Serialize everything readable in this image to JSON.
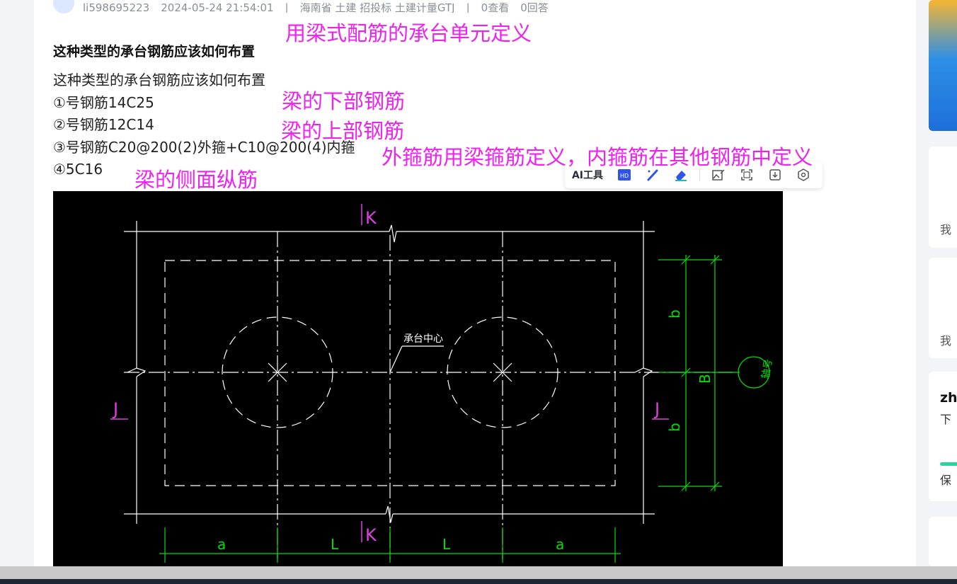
{
  "post": {
    "meta": {
      "username": "li598695223",
      "datetime": "2024-05-24 21:54:01",
      "region": "海南省  土建  招投标  土建计量GTJ",
      "views": "0查看",
      "answers": "0回答"
    },
    "title": "这种类型的承台钢筋应该如何布置",
    "lines": [
      "这种类型的承台钢筋应该如何布置",
      "①号钢筋14C25",
      "②号钢筋12C14",
      "③号钢筋C20@200(2)外箍+C10@200(4)内箍",
      "④5C16"
    ]
  },
  "annotations": {
    "a1": "用梁式配筋的承台单元定义",
    "a2": "梁的下部钢筋",
    "a3": "梁的上部钢筋",
    "a4": "外箍筋用梁箍筋定义，内箍筋在其他钢筋中定义",
    "a5": "梁的侧面纵筋"
  },
  "toolbar": {
    "ai_label": "AI工具",
    "icons": [
      "hd-icon",
      "brush-icon",
      "eraser-icon",
      "image-edit-icon",
      "crop-icon",
      "download-icon",
      "settings-icon"
    ]
  },
  "drawing": {
    "center_label": "承台中心",
    "axis_K_top": "K",
    "axis_K_bottom": "K",
    "axis_J_left": "J",
    "axis_J_right": "J",
    "axis_label": "轴号",
    "dim_b1": "b",
    "dim_b2": "b",
    "dim_B": "B",
    "dim_a1": "a",
    "dim_L1": "L",
    "dim_L2": "L",
    "dim_a2": "a",
    "colors": {
      "white": "#ffffff",
      "green": "#00e000",
      "magenta": "#e040e0"
    }
  },
  "sidebar": {
    "t1": "我",
    "t2": "我",
    "t3_bold": "zh",
    "t3": "下",
    "t4": "保"
  }
}
